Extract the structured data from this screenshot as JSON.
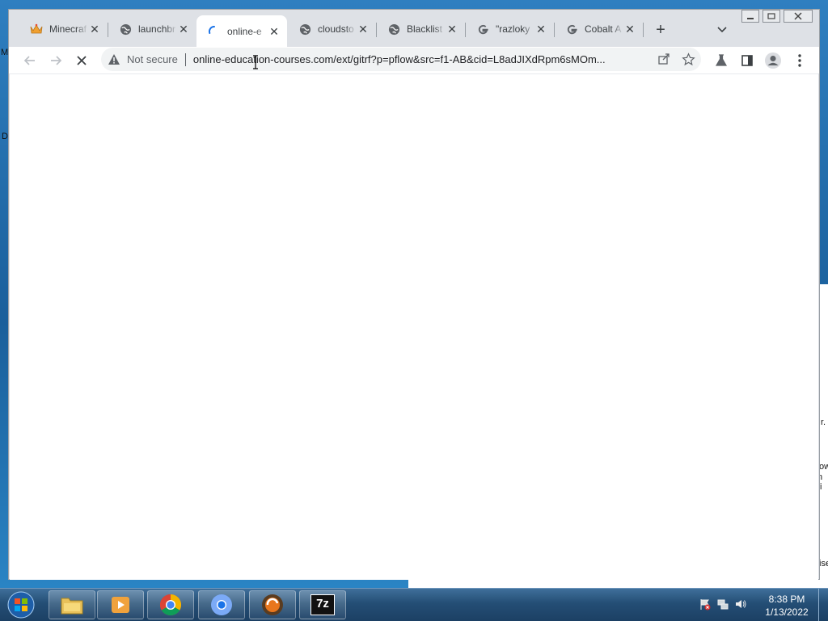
{
  "desktop": {
    "fragments": [
      "M",
      "D",
      "r.",
      "ow",
      "n fi",
      "ise"
    ]
  },
  "browser": {
    "tabs": [
      {
        "title": "Minecraf",
        "favicon": "crown-icon",
        "active": false
      },
      {
        "title": "launchbr",
        "favicon": "globe-icon",
        "active": false
      },
      {
        "title": "online-e",
        "favicon": "loading-spinner-icon",
        "active": true
      },
      {
        "title": "cloudsto",
        "favicon": "globe-icon",
        "active": false
      },
      {
        "title": "Blacklist",
        "favicon": "globe-icon",
        "active": false
      },
      {
        "title": "\"razloky",
        "favicon": "google-g-icon",
        "active": false
      },
      {
        "title": "Cobalt A",
        "favicon": "google-g-icon",
        "active": false
      }
    ],
    "toolbar": {
      "security_label": "Not secure",
      "url": "online-education-courses.com/ext/gitrf?p=pflow&src=f1-AB&cid=L8adJIXdRpm6sMOm..."
    }
  },
  "taskbar": {
    "apps": [
      "file-explorer-icon",
      "media-player-icon",
      "chrome-icon",
      "chromium-icon",
      "orange-app-icon",
      "7zip-icon"
    ],
    "sevenzip_label": "7z",
    "clock": {
      "time": "8:38 PM",
      "date": "1/13/2022"
    }
  },
  "colors": {
    "accent": "#1a73e8",
    "taskbar": "#244e75",
    "tabstrip": "#dee1e6"
  }
}
